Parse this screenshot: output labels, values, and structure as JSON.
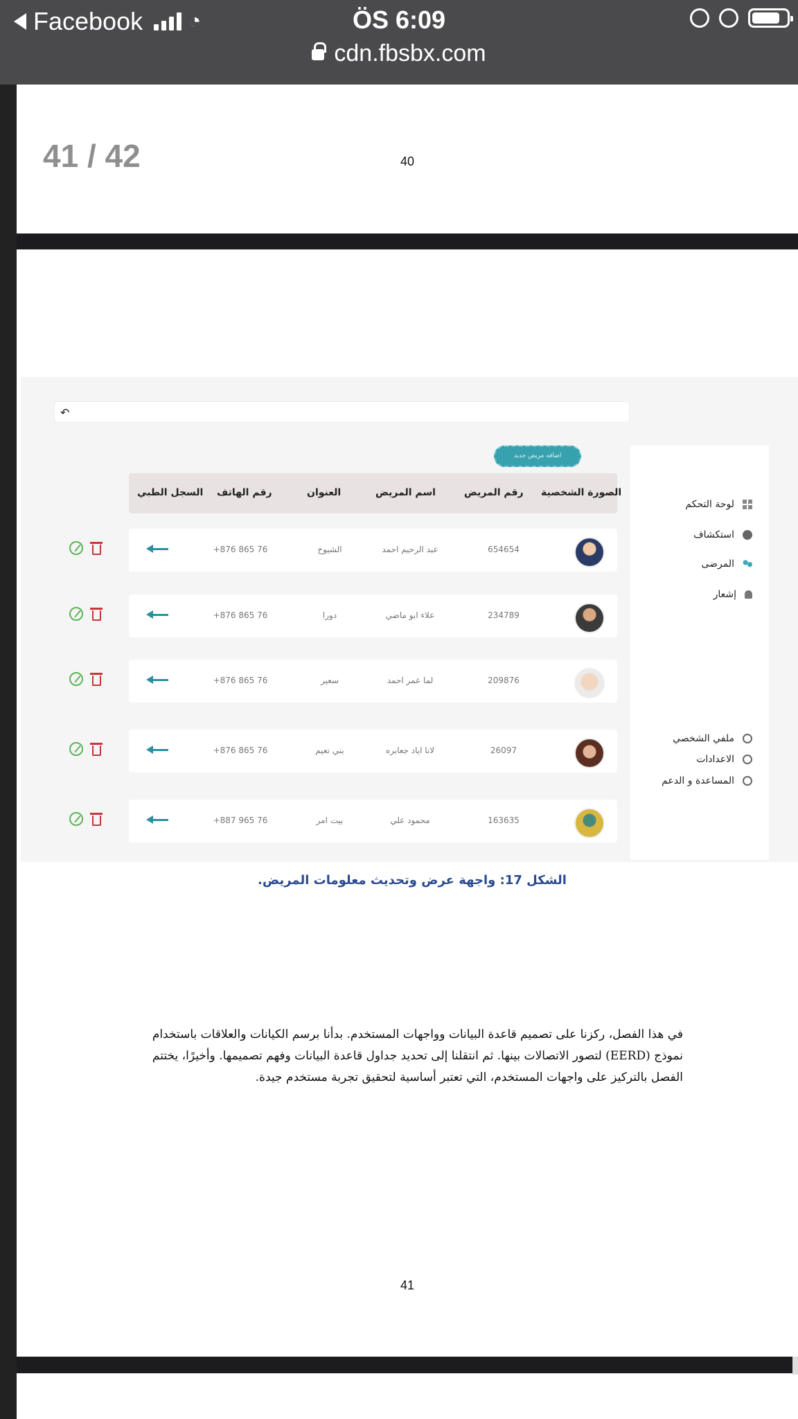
{
  "statusbar": {
    "back_app": "Facebook",
    "time": "ÖS 6:09",
    "url": "cdn.fbsbx.com"
  },
  "viewer": {
    "page_counter": "41 / 42",
    "prev_page_number": "40",
    "page_number": "41"
  },
  "app": {
    "add_button": "اضافه مريض جديد",
    "sidebar": {
      "top_items": [
        {
          "label": "لوحة التحكم",
          "icon": "grid-icon"
        },
        {
          "label": "استكشاف",
          "icon": "compass-icon"
        },
        {
          "label": "المرضى",
          "icon": "people-icon"
        },
        {
          "label": "إشعار",
          "icon": "bell-icon"
        }
      ],
      "bottom_items": [
        {
          "label": "ملفي الشخصي",
          "icon": "user-icon"
        },
        {
          "label": "الاعدادات",
          "icon": "gear-icon"
        },
        {
          "label": "المساعدة و الدعم",
          "icon": "help-icon"
        }
      ]
    },
    "table": {
      "headers": [
        "الصورة الشخصية",
        "رقم المريض",
        "اسم المريض",
        "العنوان",
        "رقم الهاتف",
        "السجل الطبي"
      ],
      "rows": [
        {
          "id": "654654",
          "name": "عبد الرحيم احمد",
          "address": "الشيوخ",
          "phone": "+876 865 76"
        },
        {
          "id": "234789",
          "name": "علاء ابو ماضي",
          "address": "دورا",
          "phone": "+876 865 76"
        },
        {
          "id": "209876",
          "name": "لما عمر احمد",
          "address": "سعير",
          "phone": "+876 865 76"
        },
        {
          "id": "26097",
          "name": "لانا  اياد جعابره",
          "address": "بني نعيم",
          "phone": "+876 865 76"
        },
        {
          "id": "163635",
          "name": "محمود علي",
          "address": "بيت امر",
          "phone": "+887 965 76"
        }
      ]
    }
  },
  "document": {
    "caption": "الشكل 17: واجهة عرض وتحديث معلومات المريض.",
    "paragraph": "في هذا الفصل، ركزنا على تصميم قاعدة البيانات وواجهات المستخدم. بدأنا برسم الكيانات والعلاقات باستخدام نموذج (EERD) لتصور الاتصالات بينها. ثم انتقلنا إلى تحديد جداول قاعدة البيانات وفهم تصميمها. وأخيرًا، يختتم الفصل بالتركيز على واجهات المستخدم، التي تعتبر أساسية لتحقيق تجربة مستخدم جيدة."
  },
  "colors": {
    "accent": "#37a1ae",
    "delete": "#c0393b",
    "edit": "#5bb557",
    "caption": "#2a4a8f"
  }
}
